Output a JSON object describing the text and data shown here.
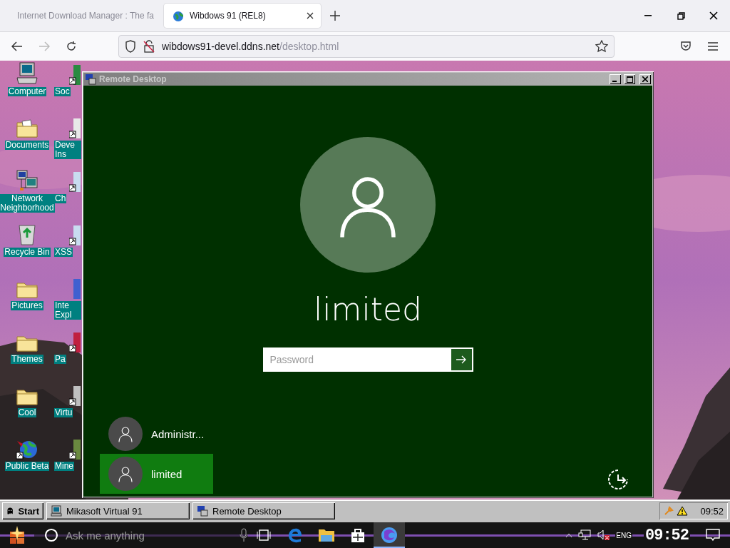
{
  "browser": {
    "tabs": [
      {
        "title": "Internet Download Manager : The fa",
        "selected": false
      },
      {
        "title": "Wibdows 91 (REL8)",
        "selected": true
      }
    ],
    "address": {
      "host": "wibdows91-devel.ddns.net",
      "path": "/desktop.html"
    }
  },
  "desktop": {
    "icons": [
      {
        "label": "Computer"
      },
      {
        "label": "Documents"
      },
      {
        "label": "Network Neighborhood"
      },
      {
        "label": "Recycle Bin"
      },
      {
        "label": "Pictures"
      },
      {
        "label": "Themes"
      },
      {
        "label": "Cool"
      },
      {
        "label": "Public Beta"
      }
    ],
    "partial_icons": [
      {
        "label": "Soc"
      },
      {
        "label": "Deve Ins"
      },
      {
        "label": "Ch"
      },
      {
        "label": "XSS"
      },
      {
        "label": "Inte Expl"
      },
      {
        "label": "Pa"
      },
      {
        "label": "Virtu"
      },
      {
        "label": "Mine"
      }
    ]
  },
  "window": {
    "title": "Remote Desktop",
    "active": false,
    "login": {
      "user": "limited",
      "password": {
        "placeholder": "Password"
      },
      "users": [
        {
          "name": "Administr...",
          "selected": false
        },
        {
          "name": "limited",
          "selected": true
        }
      ]
    }
  },
  "taskbar": {
    "start": "Start",
    "tasks": [
      {
        "label": "Mikasoft Virtual 91"
      },
      {
        "label": "Remote Desktop"
      }
    ],
    "clock": "09:52"
  },
  "host_taskbar": {
    "search": {
      "placeholder": "Ask me anything"
    },
    "apps": [
      {
        "active": false
      },
      {
        "active": false
      },
      {
        "active": false
      },
      {
        "active": true
      }
    ],
    "language": "ENG",
    "clock": "09:52"
  }
}
